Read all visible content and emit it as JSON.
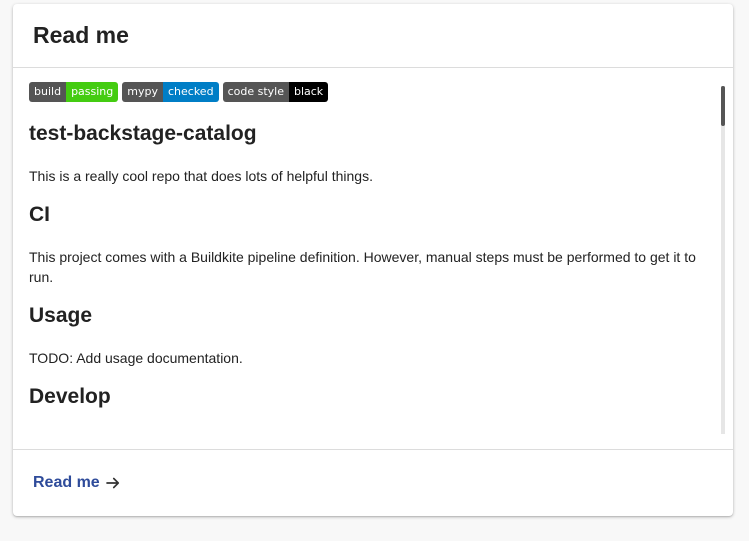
{
  "card": {
    "title": "Read me"
  },
  "badges": [
    {
      "label": "build",
      "value": "passing"
    },
    {
      "label": "mypy",
      "value": "checked"
    },
    {
      "label": "code style",
      "value": "black"
    }
  ],
  "readme": {
    "h1": "test-backstage-catalog",
    "intro": "This is a really cool repo that does lots of helpful things.",
    "ci_heading": "CI",
    "ci_text": "This project comes with a Buildkite pipeline definition. However, manual steps must be performed to get it to run.",
    "usage_heading": "Usage",
    "usage_text": "TODO: Add usage documentation.",
    "develop_heading": "Develop"
  },
  "footer": {
    "link_label": "Read me",
    "link_icon": "arrow-right-icon"
  },
  "colors": {
    "link": "#2e4b9a",
    "badge_left": "#555555",
    "badge_passing": "#44cc11",
    "badge_checked": "#007ec6",
    "badge_black": "#000000"
  }
}
